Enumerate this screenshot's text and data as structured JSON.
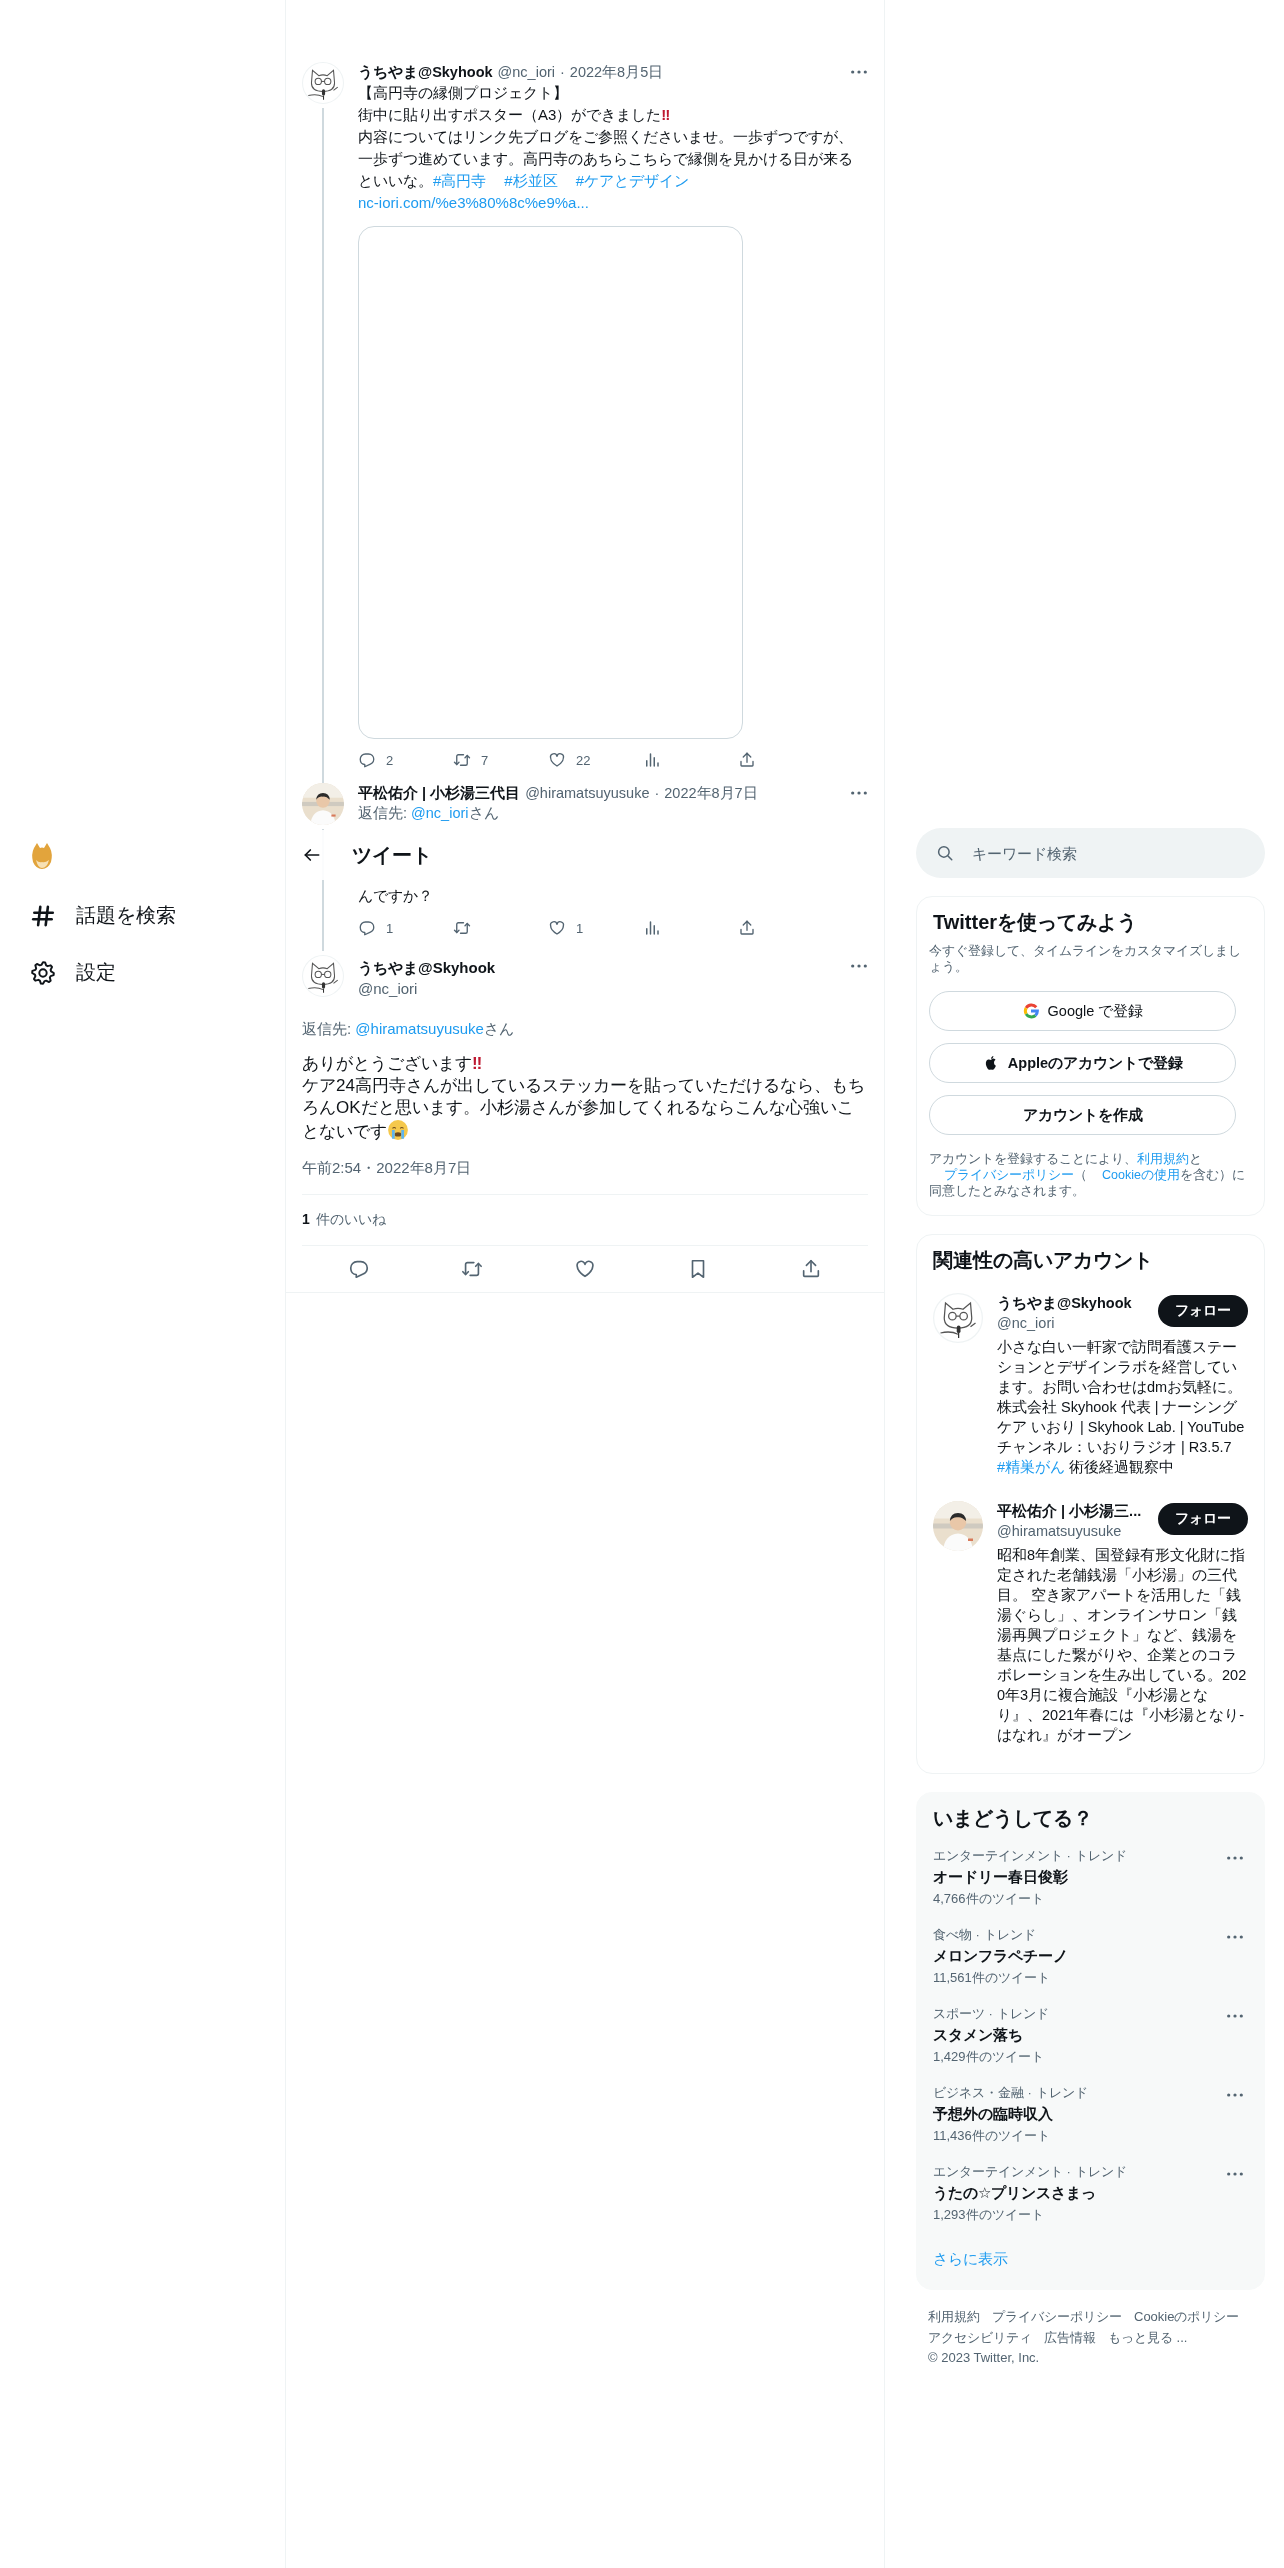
{
  "nav": {
    "items": [
      {
        "kind": "logo"
      },
      {
        "kind": "explore",
        "label": "話題を検索"
      },
      {
        "kind": "settings",
        "label": "設定"
      }
    ]
  },
  "header": {
    "title": "ツイート"
  },
  "tweets": [
    {
      "kind": "thread",
      "name": "うちやま@Skyhook",
      "handle": "@nc_iori",
      "separator": "·",
      "date": "2022年8月5日",
      "body": [
        [
          {
            "kind": "text",
            "text": "【高円寺の縁側プロジェクト】"
          }
        ],
        [
          {
            "kind": "text",
            "text": "街中に貼り出すポスター（A3）ができました"
          },
          {
            "kind": "alert",
            "text": "‼"
          }
        ],
        [
          {
            "kind": "text",
            "text": "内容についてはリンク先ブログをご参照くださいませ。一歩ずつですが、一歩ずつ進めています。高円寺のあちらこちらで縁側を見かける日が来るといいな。"
          },
          {
            "kind": "link",
            "text": "#高円寺"
          },
          {
            "kind": "link",
            "text": "#杉並区"
          },
          {
            "kind": "link",
            "text": "#ケアとデザイン"
          }
        ],
        [
          {
            "kind": "link",
            "text": "nc-iori.com/%e3%80%8c%e9%a..."
          }
        ]
      ],
      "media": true,
      "actions": [
        {
          "kind": "reply",
          "count": "2"
        },
        {
          "kind": "retweet",
          "count": "7"
        },
        {
          "kind": "like",
          "count": "22"
        },
        {
          "kind": "views"
        },
        {
          "kind": "share"
        }
      ]
    },
    {
      "kind": "thread",
      "avatar": {
        "kind": "picture"
      },
      "name": "平松佑介 | 小杉湯三代目",
      "handle": "@hiramatsuyusuke",
      "separator": "·",
      "date": "2022年8月7日",
      "reply_label": "返信先:",
      "reply_to": "@nc_iori",
      "reply_suffix": "さん",
      "body": [
        [
          {
            "kind": "text",
            "text": "んですか？"
          }
        ]
      ],
      "actions": [
        {
          "kind": "reply",
          "count": "1"
        },
        {
          "kind": "retweet"
        },
        {
          "kind": "like",
          "count": "1"
        },
        {
          "kind": "views"
        },
        {
          "kind": "share"
        }
      ]
    },
    {
      "kind": "focal",
      "name": "うちやま@Skyhook",
      "handle": "@nc_iori",
      "reply_label": "返信先:",
      "reply_to": "@hiramatsuyusuke",
      "reply_suffix": "さん",
      "body": [
        [
          {
            "kind": "text",
            "text": "ありがとうございます"
          },
          {
            "kind": "alert",
            "text": "‼"
          }
        ],
        [
          {
            "kind": "text",
            "text": "ケア24高円寺さんが出しているステッカーを貼っていただけるなら、もちろんOKだと思います。小杉湯さんが参加してくれるならこんな心強いことないです"
          },
          {
            "kind": "crying-emoji"
          }
        ]
      ],
      "timestamp": "午前2:54・2022年8月7日",
      "likes": {
        "count": "1",
        "label": "件のいいね"
      },
      "actions": [
        {
          "kind": "reply"
        },
        {
          "kind": "retweet"
        },
        {
          "kind": "like"
        },
        {
          "kind": "bookmark"
        },
        {
          "kind": "share"
        }
      ]
    }
  ],
  "search": {
    "placeholder": "キーワード検索"
  },
  "signup": {
    "title": "Twitterを使ってみよう",
    "subtitle": "今すぐ登録して、タイムラインをカスタマイズしましょう。",
    "buttons": [
      {
        "kind": "google",
        "label": "Google で登録"
      },
      {
        "kind": "apple",
        "label": "Appleのアカウントで登録"
      },
      {
        "kind": "plain",
        "label": "アカウントを作成"
      }
    ],
    "legal": [
      {
        "kind": "text",
        "text": "アカウントを登録することにより、"
      },
      {
        "kind": "link",
        "text": "利用規約"
      },
      {
        "kind": "text",
        "text": "と"
      },
      {
        "kind": "link",
        "text": "プライバシーポリシー"
      },
      {
        "kind": "text",
        "text": "（"
      },
      {
        "kind": "link",
        "text": "Cookieの使用"
      },
      {
        "kind": "text",
        "text": "を含む）に同意したとみなされます。"
      }
    ]
  },
  "accounts": {
    "title": "関連性の高いアカウント",
    "items": [
      {
        "name": "うちやま@Skyhook",
        "handle": "@nc_iori",
        "button": "フォロー",
        "bio": [
          {
            "kind": "text",
            "text": "小さな白い一軒家で訪問看護ステーションとデザインラボを経営しています。お問い合わせはdmお気軽に。株式会社 Skyhook 代表 | ナーシングケア いおり | Skyhook Lab. | YouTube チャンネル：いおりラジオ | R3.5.7 "
          },
          {
            "kind": "link",
            "text": "#精巣がん"
          },
          {
            "kind": "text",
            "text": " 術後経過観察中"
          }
        ]
      },
      {
        "avatar": {
          "kind": "picture"
        },
        "name": "平松佑介 | 小杉湯三...",
        "handle": "@hiramatsuyusuke",
        "button": "フォロー",
        "bio": [
          {
            "kind": "text",
            "text": "昭和8年創業、国登録有形文化財に指定された老舗銭湯「小杉湯」の三代目。 空き家アパートを活用した「銭湯ぐらし」、オンラインサロン「銭湯再興プロジェクト」など、銭湯を基点にした繋がりや、企業とのコラボレーションを生み出している。2020年3月に複合施設『小杉湯となり』、2021年春には『小杉湯となり-はなれ』がオープン"
          }
        ]
      }
    ]
  },
  "trends": {
    "title": "いまどうしてる？",
    "items": [
      {
        "category": "エンターテインメント · トレンド",
        "title": "オードリー春日俊彰",
        "count": "4,766件のツイート"
      },
      {
        "category": "食べ物 · トレンド",
        "title": "メロンフラペチーノ",
        "count": "11,561件のツイート"
      },
      {
        "category": "スポーツ · トレンド",
        "title": "スタメン落ち",
        "count": "1,429件のツイート"
      },
      {
        "category": "ビジネス・金融 · トレンド",
        "title": "予想外の臨時収入",
        "count": "11,436件のツイート"
      },
      {
        "category": "エンターテインメント · トレンド",
        "title": "うたの☆プリンスさまっ",
        "count": "1,293件のツイート"
      }
    ],
    "more": "さらに表示"
  },
  "footer": {
    "links": [
      "利用規約",
      "プライバシーポリシー",
      "Cookieのポリシー",
      "アクセシビリティ",
      "広告情報",
      "もっと見る ..."
    ],
    "copyright": "© 2023 Twitter, Inc."
  }
}
